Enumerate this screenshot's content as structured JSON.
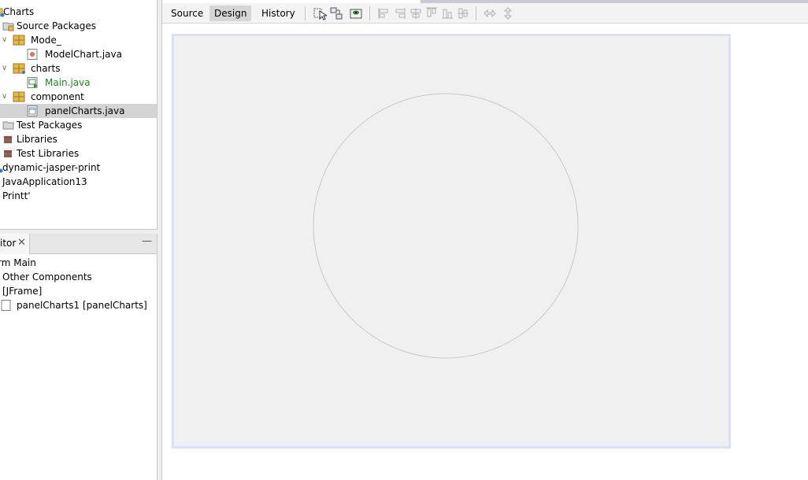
{
  "projects": {
    "rows": [
      {
        "label": "Charts"
      },
      {
        "label": "Source Packages"
      },
      {
        "label": "Mode_"
      },
      {
        "label": "ModelChart.java"
      },
      {
        "label": "charts"
      },
      {
        "label": "Main.java"
      },
      {
        "label": "component"
      },
      {
        "label": "panelCharts.java"
      },
      {
        "label": "Test Packages"
      },
      {
        "label": "Libraries"
      },
      {
        "label": "Test Libraries"
      },
      {
        "label": "dynamic-jasper-print"
      },
      {
        "label": "JavaApplication13"
      },
      {
        "label": "Printt'"
      }
    ]
  },
  "navigator": {
    "tab_label": "itor",
    "close_glyph": "✕",
    "minimize_glyph": "—",
    "rows": [
      {
        "label": "rm Main"
      },
      {
        "label": "Other Components"
      },
      {
        "label": "[JFrame]"
      },
      {
        "label": "panelCharts1 [panelCharts]"
      }
    ]
  },
  "editor": {
    "tabs": [
      {
        "label": "Source"
      },
      {
        "label": "Design",
        "active": true
      },
      {
        "label": "History"
      }
    ],
    "toolbar_icons": [
      "selection-mode-icon",
      "connection-mode-icon",
      "preview-design-icon",
      "align-left-icon",
      "align-right-icon",
      "center-horizontal-icon",
      "align-top-icon",
      "align-bottom-icon",
      "center-vertical-icon",
      "resize-horizontal-icon",
      "resize-vertical-icon"
    ]
  },
  "colors": {
    "canvas_bg": "#f0f0f0",
    "canvas_border": "#dbe0f8",
    "selection": "#d4d4d4",
    "java_green": "#1a8a1a",
    "package_yellow": "#e7b94a"
  }
}
